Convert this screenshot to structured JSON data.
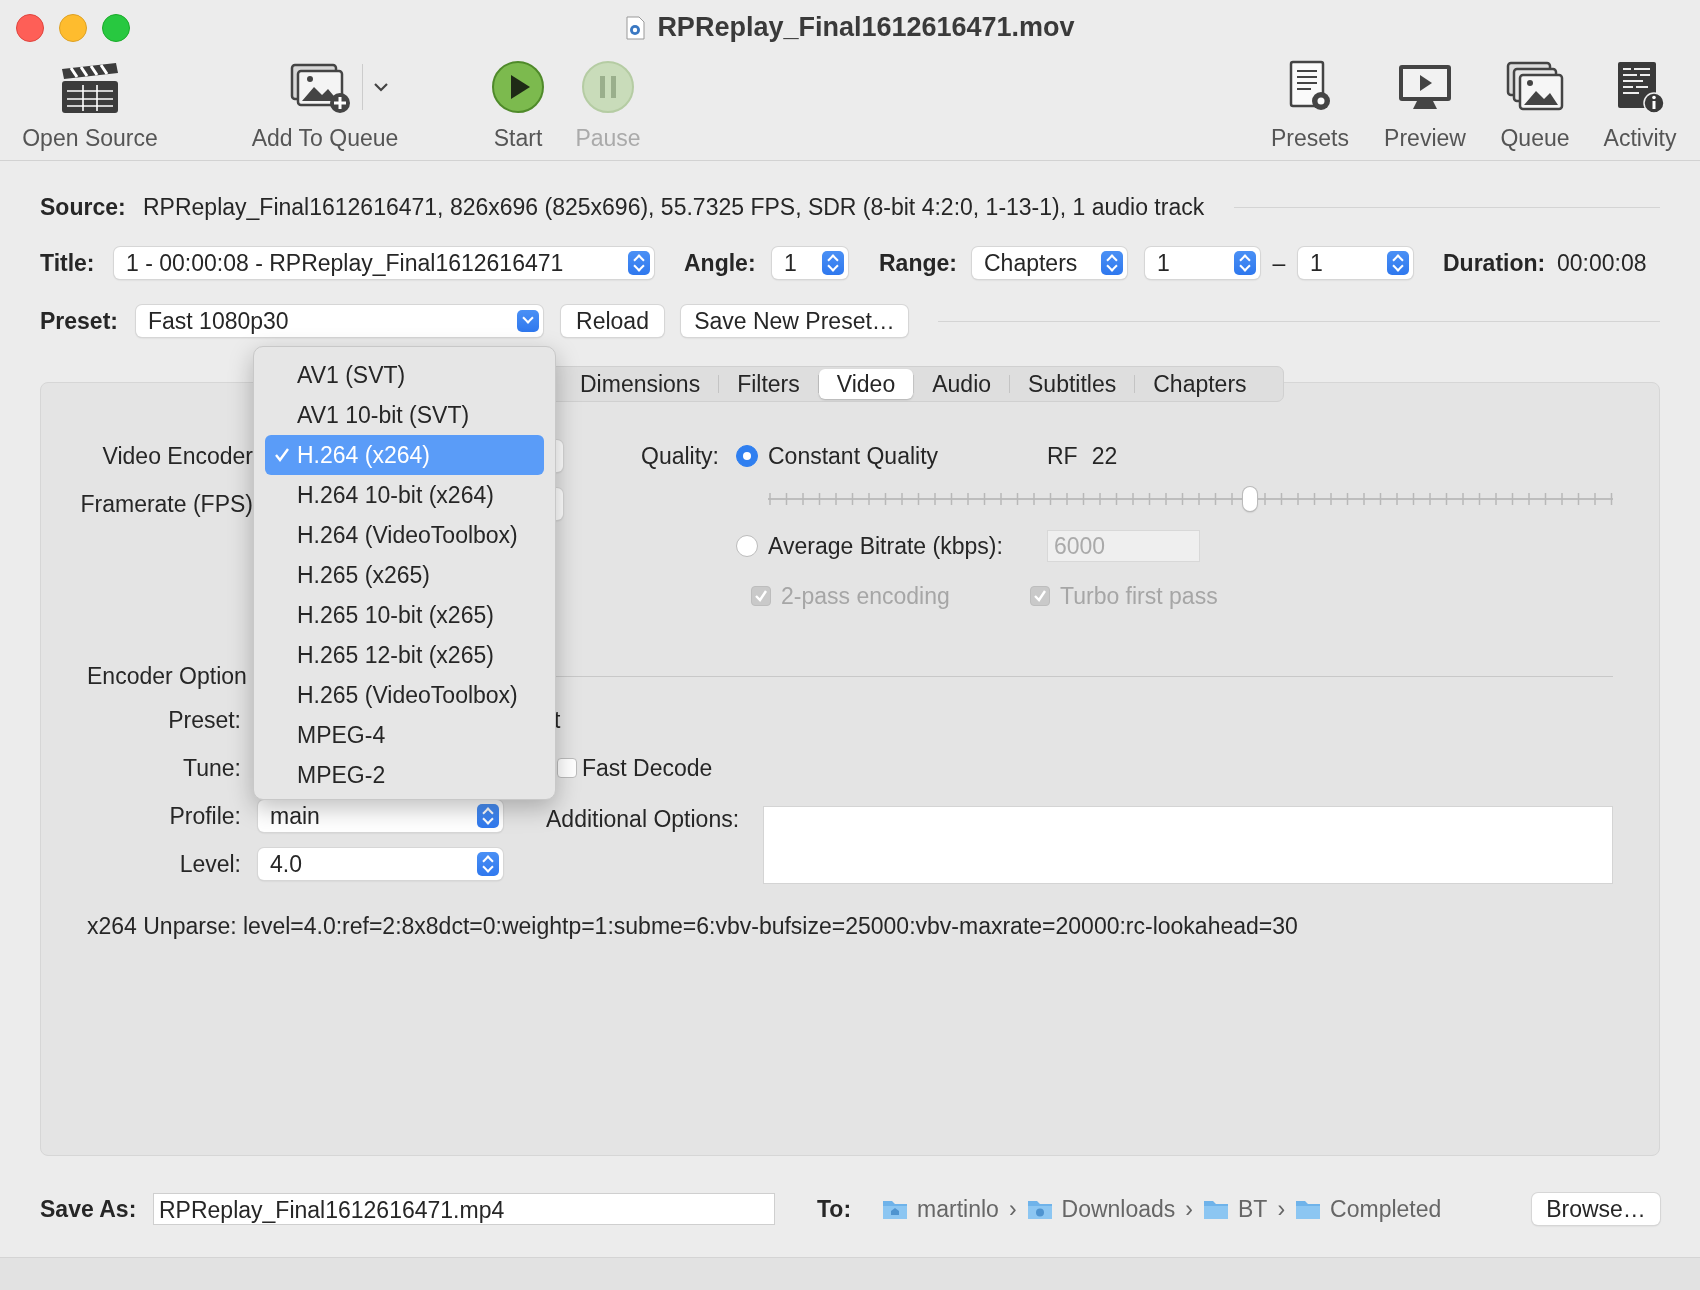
{
  "window": {
    "title": "RPReplay_Final1612616471.mov"
  },
  "left_tools": [
    {
      "label": "Open Source",
      "disabled": false,
      "dropdown": false
    },
    {
      "label": "Add To Queue",
      "disabled": false,
      "dropdown": true
    },
    {
      "label": "Start",
      "disabled": false,
      "dropdown": false
    },
    {
      "label": "Pause",
      "disabled": true,
      "dropdown": false
    }
  ],
  "right_tools": [
    {
      "label": "Presets"
    },
    {
      "label": "Preview"
    },
    {
      "label": "Queue"
    },
    {
      "label": "Activity"
    }
  ],
  "source": {
    "label": "Source:",
    "value": "RPReplay_Final1612616471, 826x696 (825x696), 55.7325 FPS, SDR (8-bit 4:2:0, 1-13-1), 1 audio track"
  },
  "title_row": {
    "label": "Title:",
    "value": "1 - 00:00:08 - RPReplay_Final1612616471",
    "angle_label": "Angle:",
    "angle": "1",
    "range_label": "Range:",
    "range_mode": "Chapters",
    "range_start": "1",
    "range_separator": "–",
    "range_end": "1",
    "duration_label": "Duration:",
    "duration": "00:00:08"
  },
  "preset_row": {
    "label": "Preset:",
    "value": "Fast 1080p30",
    "buttons": [
      "Reload",
      "Save New Preset…"
    ]
  },
  "tabs": [
    {
      "label": "Dimensions",
      "selected": false
    },
    {
      "label": "Filters",
      "selected": false
    },
    {
      "label": "Video",
      "selected": true
    },
    {
      "label": "Audio",
      "selected": false
    },
    {
      "label": "Subtitles",
      "selected": false
    },
    {
      "label": "Chapters",
      "selected": false
    }
  ],
  "video": {
    "encoder_label": "Video Encoder",
    "framerate_label": "Framerate (FPS)",
    "quality_label": "Quality:",
    "quality_modes": [
      {
        "label": "Constant Quality",
        "selected": true
      },
      {
        "label": "Average Bitrate (kbps):",
        "selected": false
      }
    ],
    "rf_label": "RF",
    "rf_value": "22",
    "quality_slider": {
      "level": 0.57
    },
    "bitrate": {
      "value": "6000",
      "disabled": true
    },
    "pass_options": [
      {
        "label": "2-pass encoding",
        "checked": true,
        "disabled": true
      },
      {
        "label": "Turbo first pass",
        "checked": true,
        "disabled": true
      }
    ],
    "encoder_options_label": "Encoder Option",
    "preset_label": "Preset:",
    "preset_value": "t",
    "tune_label": "Tune:",
    "fast_decode": {
      "label": "Fast Decode",
      "checked": false
    },
    "profile_label": "Profile:",
    "profile": "main",
    "additional_label": "Additional Options:",
    "level_label": "Level:",
    "level_value": "4.0",
    "unparse": "x264 Unparse: level=4.0:ref=2:8x8dct=0:weightp=1:subme=6:vbv-bufsize=25000:vbv-maxrate=20000:rc-lookahead=30"
  },
  "encoder_menu": [
    {
      "label": "AV1 (SVT)",
      "selected": false
    },
    {
      "label": "AV1 10-bit (SVT)",
      "selected": false
    },
    {
      "label": "H.264 (x264)",
      "selected": true
    },
    {
      "label": "H.264 10-bit (x264)",
      "selected": false
    },
    {
      "label": "H.264 (VideoToolbox)",
      "selected": false
    },
    {
      "label": "H.265 (x265)",
      "selected": false
    },
    {
      "label": "H.265 10-bit (x265)",
      "selected": false
    },
    {
      "label": "H.265 12-bit (x265)",
      "selected": false
    },
    {
      "label": "H.265 (VideoToolbox)",
      "selected": false
    },
    {
      "label": "MPEG-4",
      "selected": false
    },
    {
      "label": "MPEG-2",
      "selected": false
    }
  ],
  "save_as": {
    "label": "Save As:",
    "value": "RPReplay_Final1612616471.mp4"
  },
  "destination": {
    "label": "To:",
    "separator": "›",
    "path": [
      "martinlo",
      "Downloads",
      "BT",
      "Completed"
    ],
    "button": "Browse…"
  }
}
